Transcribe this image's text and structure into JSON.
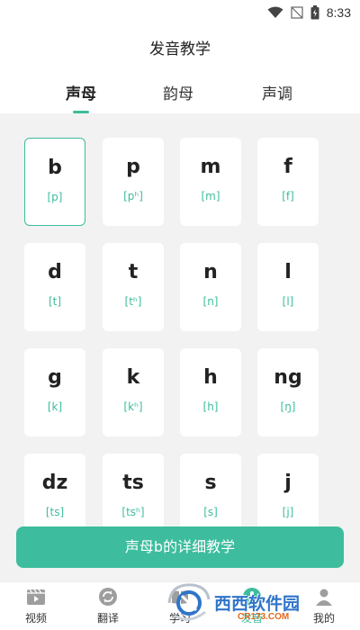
{
  "status_bar": {
    "time": "8:33"
  },
  "header": {
    "title": "发音教学"
  },
  "tabs": [
    {
      "label": "声母"
    },
    {
      "label": "韵母"
    },
    {
      "label": "声调"
    }
  ],
  "cards": [
    {
      "letter": "b",
      "ipa": "[p]"
    },
    {
      "letter": "p",
      "ipa": "[pʰ]"
    },
    {
      "letter": "m",
      "ipa": "[m]"
    },
    {
      "letter": "f",
      "ipa": "[f]"
    },
    {
      "letter": "d",
      "ipa": "[t]"
    },
    {
      "letter": "t",
      "ipa": "[tʰ]"
    },
    {
      "letter": "n",
      "ipa": "[n]"
    },
    {
      "letter": "l",
      "ipa": "[l]"
    },
    {
      "letter": "g",
      "ipa": "[k]"
    },
    {
      "letter": "k",
      "ipa": "[kʰ]"
    },
    {
      "letter": "h",
      "ipa": "[h]"
    },
    {
      "letter": "ng",
      "ipa": "[ŋ]"
    },
    {
      "letter": "dz",
      "ipa": "[ts]"
    },
    {
      "letter": "ts",
      "ipa": "[tsʰ]"
    },
    {
      "letter": "s",
      "ipa": "[s]"
    },
    {
      "letter": "j",
      "ipa": "[j]"
    }
  ],
  "cta": {
    "label": "声母b的详细教学"
  },
  "bottom_nav": [
    {
      "label": "视频",
      "icon": "video-icon"
    },
    {
      "label": "翻译",
      "icon": "translate-icon"
    },
    {
      "label": "学习",
      "icon": "book-icon"
    },
    {
      "label": "发音",
      "icon": "pronunciation-icon"
    },
    {
      "label": "我的",
      "icon": "profile-icon"
    }
  ],
  "watermark": {
    "text": "西西软件园",
    "subtext": "CR173.COM"
  },
  "colors": {
    "accent": "#3dbd9d",
    "background": "#f2f2f2",
    "watermark_blue": "#2f74c9",
    "watermark_orange": "#e26a1c"
  }
}
